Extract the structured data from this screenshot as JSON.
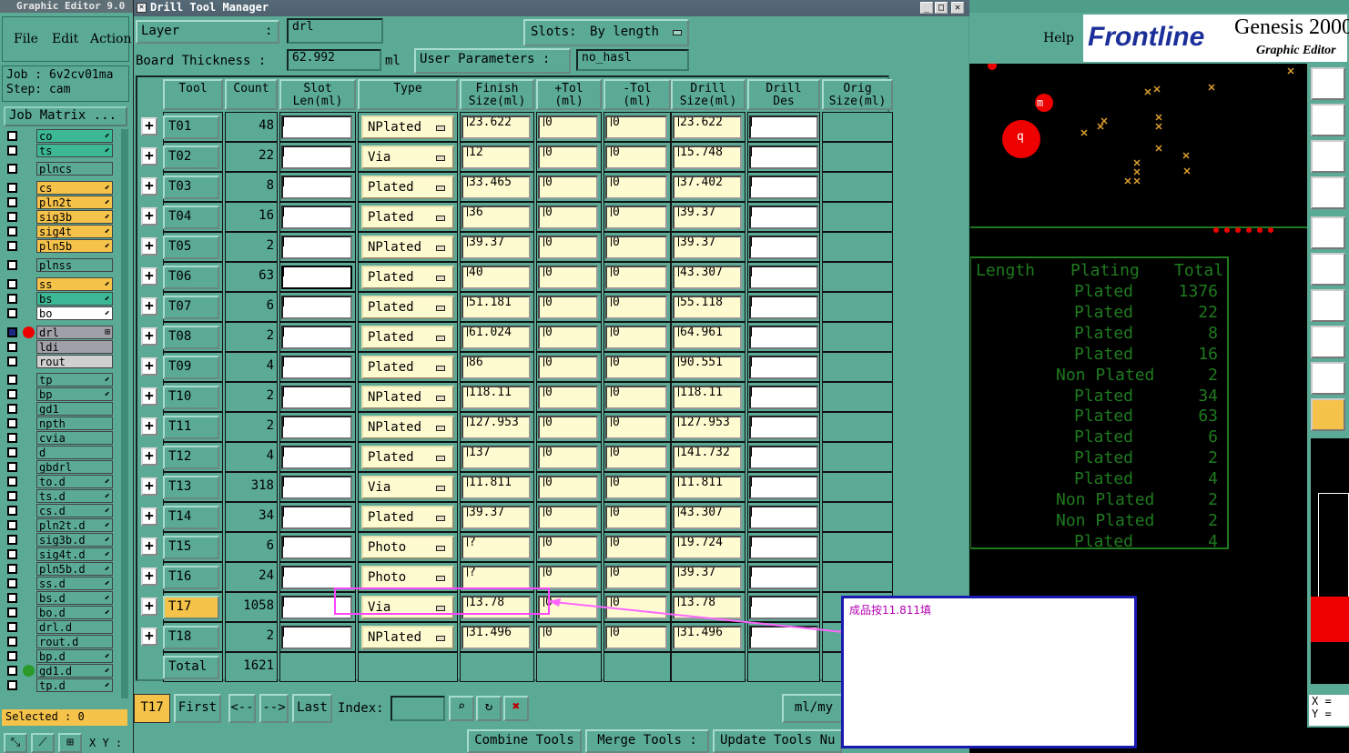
{
  "left_panel": {
    "title": "Graphic Editor 9.0",
    "menu": [
      "File",
      "Edit",
      "Action"
    ],
    "job": "Job :  6v2cv01ma",
    "step": "Step: cam",
    "job_matrix": "Job Matrix ...",
    "layers": [
      {
        "name": "co",
        "color": "#3cb896",
        "mark": "⬋"
      },
      {
        "name": "ts",
        "color": "#3cb896",
        "mark": "⬋"
      },
      {
        "name": "plncs",
        "color": "#5aaa96",
        "mark": ""
      },
      {
        "name": "cs",
        "color": "#f5c24a",
        "mark": "⬋"
      },
      {
        "name": "pln2t",
        "color": "#f5c24a",
        "mark": "⬋"
      },
      {
        "name": "sig3b",
        "color": "#f5c24a",
        "mark": "⬋"
      },
      {
        "name": "sig4t",
        "color": "#f5c24a",
        "mark": "⬋"
      },
      {
        "name": "pln5b",
        "color": "#f5c24a",
        "mark": "⬋"
      },
      {
        "name": "plnss",
        "color": "#5aaa96",
        "mark": ""
      },
      {
        "name": "ss",
        "color": "#f5c24a",
        "mark": "⬋"
      },
      {
        "name": "bs",
        "color": "#3cb896",
        "mark": "⬋"
      },
      {
        "name": "bo",
        "color": "#ffffff",
        "mark": "⬋"
      },
      {
        "name": "drl",
        "color": "#a0a0a8",
        "mark": "⊞"
      },
      {
        "name": "ldi",
        "color": "#a0a0a8",
        "mark": ""
      },
      {
        "name": "rout",
        "color": "#d0d0d0",
        "mark": ""
      },
      {
        "name": "tp",
        "color": "#5aaa96",
        "mark": "⬋"
      },
      {
        "name": "bp",
        "color": "#5aaa96",
        "mark": "⬋"
      },
      {
        "name": "gd1",
        "color": "#5aaa96",
        "mark": ""
      },
      {
        "name": "npth",
        "color": "#5aaa96",
        "mark": ""
      },
      {
        "name": "cvia",
        "color": "#5aaa96",
        "mark": ""
      },
      {
        "name": "d",
        "color": "#5aaa96",
        "mark": ""
      },
      {
        "name": "gbdrl",
        "color": "#5aaa96",
        "mark": ""
      },
      {
        "name": "to.d",
        "color": "#5aaa96",
        "mark": "⬋"
      },
      {
        "name": "ts.d",
        "color": "#5aaa96",
        "mark": "⬋"
      },
      {
        "name": "cs.d",
        "color": "#5aaa96",
        "mark": "⬋"
      },
      {
        "name": "pln2t.d",
        "color": "#5aaa96",
        "mark": "⬋"
      },
      {
        "name": "sig3b.d",
        "color": "#5aaa96",
        "mark": "⬋"
      },
      {
        "name": "sig4t.d",
        "color": "#5aaa96",
        "mark": "⬋"
      },
      {
        "name": "pln5b.d",
        "color": "#5aaa96",
        "mark": "⬋"
      },
      {
        "name": "ss.d",
        "color": "#5aaa96",
        "mark": "⬋"
      },
      {
        "name": "bs.d",
        "color": "#5aaa96",
        "mark": "⬋"
      },
      {
        "name": "bo.d",
        "color": "#5aaa96",
        "mark": "⬋"
      },
      {
        "name": "drl.d",
        "color": "#5aaa96",
        "mark": ""
      },
      {
        "name": "rout.d",
        "color": "#5aaa96",
        "mark": ""
      },
      {
        "name": "bp.d",
        "color": "#5aaa96",
        "mark": "⬋"
      },
      {
        "name": "gd1.d",
        "color": "#5aaa96",
        "mark": "⬋"
      },
      {
        "name": "tp.d",
        "color": "#5aaa96",
        "mark": "⬋"
      }
    ],
    "selected": "Selected : 0",
    "xy_label": "X Y :"
  },
  "dtm": {
    "title": "Drill Tool Manager",
    "layer_label": "Layer",
    "layer_colon": ":",
    "layer_value": "drl",
    "slots_label": "Slots:",
    "slots_value": "By length",
    "thickness_label": "Board Thickness  :",
    "thickness_value": "62.992",
    "thickness_unit": "ml",
    "user_params_label": "User Parameters  :",
    "user_params_value": "no_hasl",
    "columns": [
      "Tool",
      "Count",
      "Slot\nLen(ml)",
      "Type",
      "Finish\nSize(ml)",
      "+Tol\n(ml)",
      "-Tol\n(ml)",
      "Drill\nSize(ml)",
      "Drill\nDes",
      "Orig\nSize(ml)"
    ],
    "rows": [
      {
        "tool": "T01",
        "count": "48",
        "type": "NPlated",
        "finish": "23.622",
        "ptol": "0",
        "ntol": "0",
        "drill": "23.622"
      },
      {
        "tool": "T02",
        "count": "22",
        "type": "Via",
        "finish": "12",
        "ptol": "0",
        "ntol": "0",
        "drill": "15.748"
      },
      {
        "tool": "T03",
        "count": "8",
        "type": "Plated",
        "finish": "33.465",
        "ptol": "0",
        "ntol": "0",
        "drill": "37.402"
      },
      {
        "tool": "T04",
        "count": "16",
        "type": "Plated",
        "finish": "36",
        "ptol": "0",
        "ntol": "0",
        "drill": "39.37"
      },
      {
        "tool": "T05",
        "count": "2",
        "type": "NPlated",
        "finish": "39.37",
        "ptol": "0",
        "ntol": "0",
        "drill": "39.37"
      },
      {
        "tool": "T06",
        "count": "63",
        "type": "Plated",
        "finish": "40",
        "ptol": "0",
        "ntol": "0",
        "drill": "43.307"
      },
      {
        "tool": "T07",
        "count": "6",
        "type": "Plated",
        "finish": "51.181",
        "ptol": "0",
        "ntol": "0",
        "drill": "55.118"
      },
      {
        "tool": "T08",
        "count": "2",
        "type": "Plated",
        "finish": "61.024",
        "ptol": "0",
        "ntol": "0",
        "drill": "64.961"
      },
      {
        "tool": "T09",
        "count": "4",
        "type": "Plated",
        "finish": "86",
        "ptol": "0",
        "ntol": "0",
        "drill": "90.551"
      },
      {
        "tool": "T10",
        "count": "2",
        "type": "NPlated",
        "finish": "118.11",
        "ptol": "0",
        "ntol": "0",
        "drill": "118.11"
      },
      {
        "tool": "T11",
        "count": "2",
        "type": "NPlated",
        "finish": "127.953",
        "ptol": "0",
        "ntol": "0",
        "drill": "127.953"
      },
      {
        "tool": "T12",
        "count": "4",
        "type": "Plated",
        "finish": "137",
        "ptol": "0",
        "ntol": "0",
        "drill": "141.732"
      },
      {
        "tool": "T13",
        "count": "318",
        "type": "Via",
        "finish": "11.811",
        "ptol": "0",
        "ntol": "0",
        "drill": "11.811"
      },
      {
        "tool": "T14",
        "count": "34",
        "type": "Plated",
        "finish": "39.37",
        "ptol": "0",
        "ntol": "0",
        "drill": "43.307"
      },
      {
        "tool": "T15",
        "count": "6",
        "type": "Photo",
        "finish": "?",
        "ptol": "0",
        "ntol": "0",
        "drill": "19.724"
      },
      {
        "tool": "T16",
        "count": "24",
        "type": "Photo",
        "finish": "?",
        "ptol": "0",
        "ntol": "0",
        "drill": "39.37"
      },
      {
        "tool": "T17",
        "count": "1058",
        "type": "Via",
        "finish": "13.78",
        "ptol": "0",
        "ntol": "0",
        "drill": "13.78"
      },
      {
        "tool": "T18",
        "count": "2",
        "type": "NPlated",
        "finish": "31.496",
        "ptol": "0",
        "ntol": "0",
        "drill": "31.496"
      }
    ],
    "total_label": "Total",
    "total_count": "1621",
    "current_tool": "T17",
    "nav_first": "First",
    "nav_prev": "<--",
    "nav_next": "-->",
    "nav_last": "Last",
    "index_label": "Index:",
    "units_button": "ml/my",
    "combine_tools": "Combine Tools",
    "merge_tools": "Merge Tools :",
    "update_tools": "Update Tools Nu"
  },
  "genesis": {
    "help": "Help",
    "logo_brand": "Frontline",
    "logo_product": "Genesis 2000",
    "logo_sub": "Graphic Editor",
    "pcb_labels": {
      "m": "m",
      "q": "q"
    },
    "table_header": [
      "Length",
      "Plating",
      "Total"
    ],
    "table_rows": [
      [
        "Plated",
        "1376"
      ],
      [
        "Plated",
        "22"
      ],
      [
        "Plated",
        "8"
      ],
      [
        "Plated",
        "16"
      ],
      [
        "Non Plated",
        "2"
      ],
      [
        "Plated",
        "34"
      ],
      [
        "Plated",
        "63"
      ],
      [
        "Plated",
        "6"
      ],
      [
        "Plated",
        "2"
      ],
      [
        "Plated",
        "4"
      ],
      [
        "Non Plated",
        "2"
      ],
      [
        "Non Plated",
        "2"
      ],
      [
        "Plated",
        "4"
      ]
    ],
    "xy_readout": [
      "X =",
      "Y ="
    ]
  },
  "annotation": {
    "text": "成品按11.811填"
  }
}
